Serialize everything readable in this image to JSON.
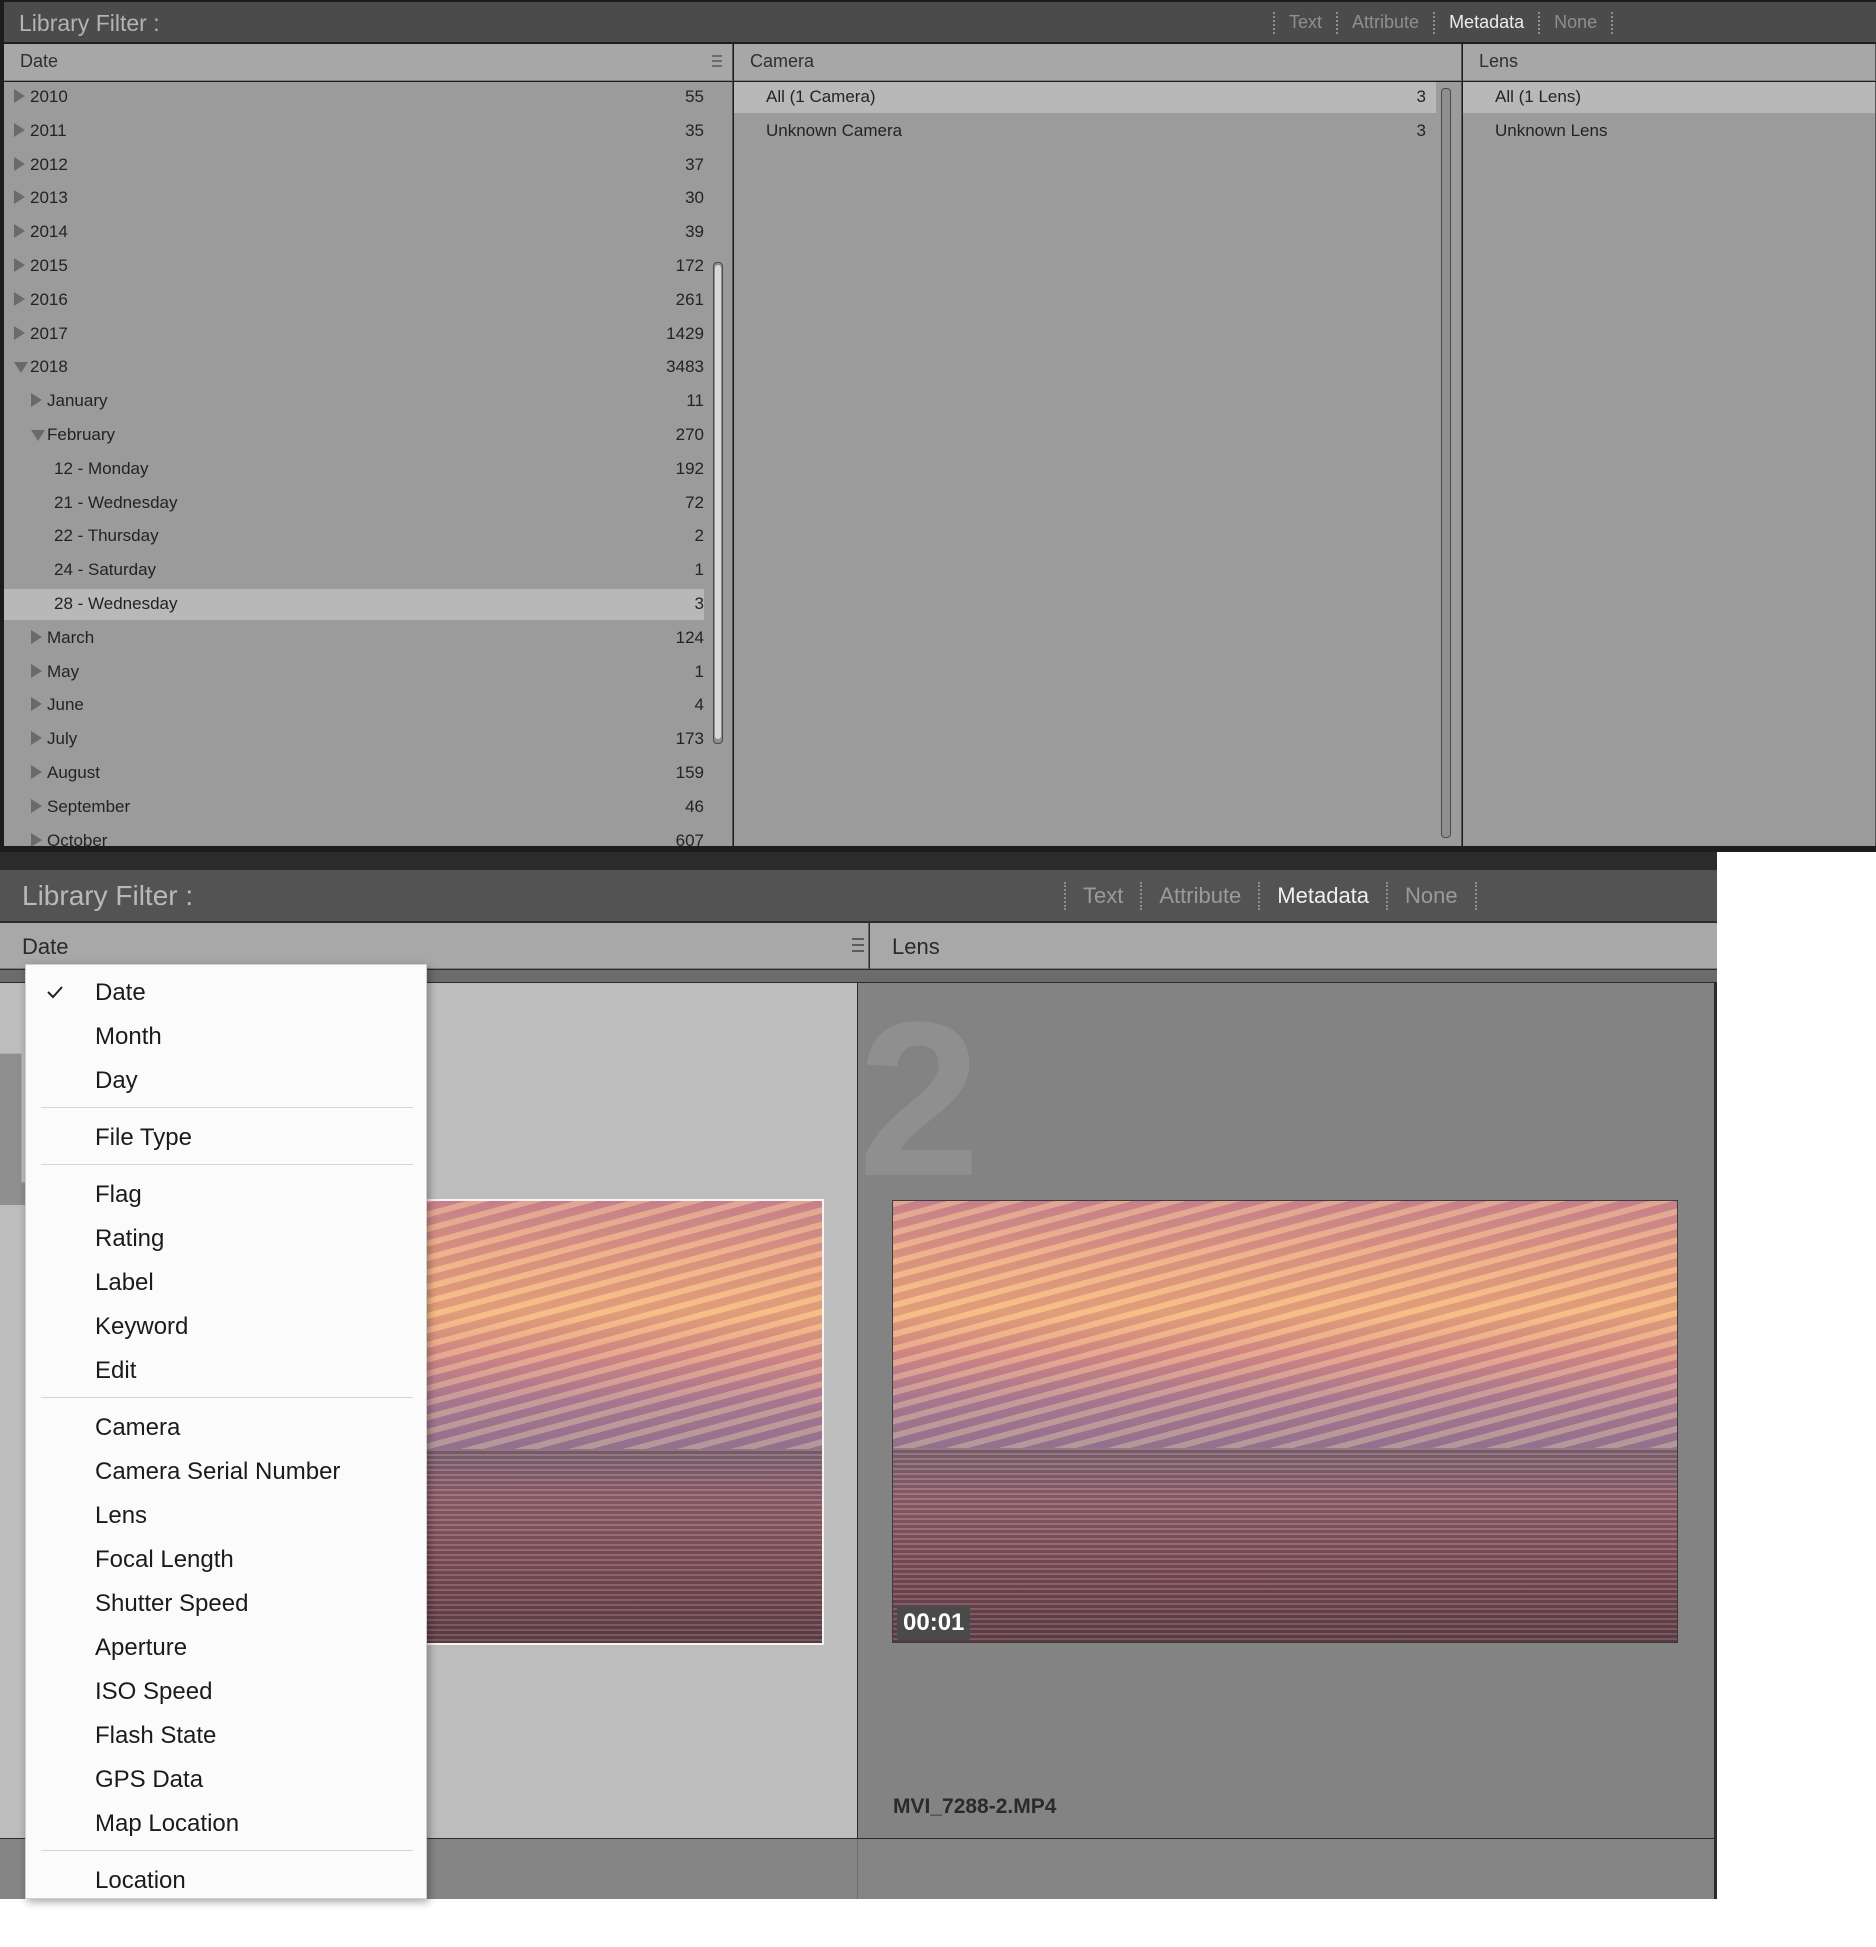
{
  "top": {
    "title": "Library Filter :",
    "tabs": [
      "Text",
      "Attribute",
      "Metadata",
      "None"
    ],
    "active_tab": "Metadata",
    "columns": {
      "date": {
        "header": "Date",
        "rows": [
          {
            "label": "2010",
            "count": "55",
            "level": 0,
            "expanded": false,
            "selected": false
          },
          {
            "label": "2011",
            "count": "35",
            "level": 0,
            "expanded": false,
            "selected": false
          },
          {
            "label": "2012",
            "count": "37",
            "level": 0,
            "expanded": false,
            "selected": false
          },
          {
            "label": "2013",
            "count": "30",
            "level": 0,
            "expanded": false,
            "selected": false
          },
          {
            "label": "2014",
            "count": "39",
            "level": 0,
            "expanded": false,
            "selected": false
          },
          {
            "label": "2015",
            "count": "172",
            "level": 0,
            "expanded": false,
            "selected": false
          },
          {
            "label": "2016",
            "count": "261",
            "level": 0,
            "expanded": false,
            "selected": false
          },
          {
            "label": "2017",
            "count": "1429",
            "level": 0,
            "expanded": false,
            "selected": false
          },
          {
            "label": "2018",
            "count": "3483",
            "level": 0,
            "expanded": true,
            "selected": false
          },
          {
            "label": "January",
            "count": "11",
            "level": 1,
            "expanded": false,
            "selected": false
          },
          {
            "label": "February",
            "count": "270",
            "level": 1,
            "expanded": true,
            "selected": false
          },
          {
            "label": "12 - Monday",
            "count": "192",
            "level": 2,
            "expanded": null,
            "selected": false
          },
          {
            "label": "21 - Wednesday",
            "count": "72",
            "level": 2,
            "expanded": null,
            "selected": false
          },
          {
            "label": "22 - Thursday",
            "count": "2",
            "level": 2,
            "expanded": null,
            "selected": false
          },
          {
            "label": "24 - Saturday",
            "count": "1",
            "level": 2,
            "expanded": null,
            "selected": false
          },
          {
            "label": "28 - Wednesday",
            "count": "3",
            "level": 2,
            "expanded": null,
            "selected": true
          },
          {
            "label": "March",
            "count": "124",
            "level": 1,
            "expanded": false,
            "selected": false
          },
          {
            "label": "May",
            "count": "1",
            "level": 1,
            "expanded": false,
            "selected": false
          },
          {
            "label": "June",
            "count": "4",
            "level": 1,
            "expanded": false,
            "selected": false
          },
          {
            "label": "July",
            "count": "173",
            "level": 1,
            "expanded": false,
            "selected": false
          },
          {
            "label": "August",
            "count": "159",
            "level": 1,
            "expanded": false,
            "selected": false
          },
          {
            "label": "September",
            "count": "46",
            "level": 1,
            "expanded": false,
            "selected": false
          },
          {
            "label": "October",
            "count": "607",
            "level": 1,
            "expanded": false,
            "selected": false
          }
        ]
      },
      "camera": {
        "header": "Camera",
        "rows": [
          {
            "label": "All (1 Camera)",
            "count": "3",
            "selected": true
          },
          {
            "label": "Unknown Camera",
            "count": "3",
            "selected": false
          }
        ]
      },
      "lens": {
        "header": "Lens",
        "rows": [
          {
            "label": "All (1 Lens)",
            "count": "",
            "selected": true
          },
          {
            "label": "Unknown Lens",
            "count": "",
            "selected": false
          }
        ]
      }
    }
  },
  "bottom": {
    "title": "Library Filter :",
    "tabs": [
      "Text",
      "Attribute",
      "Metadata",
      "None"
    ],
    "active_tab": "Metadata",
    "date_header": "Date",
    "lens_header": "Lens",
    "cells": [
      {
        "index": "1"
      },
      {
        "index": "2",
        "duration": "00:01",
        "filename": "MVI_7288-2.MP4"
      }
    ],
    "menu": {
      "groups": [
        [
          "Date",
          "Month",
          "Day"
        ],
        [
          "File Type"
        ],
        [
          "Flag",
          "Rating",
          "Label",
          "Keyword",
          "Edit"
        ],
        [
          "Camera",
          "Camera Serial Number",
          "Lens",
          "Focal Length",
          "Shutter Speed",
          "Aperture",
          "ISO Speed",
          "Flash State",
          "GPS Data",
          "Map Location"
        ],
        [
          "Location"
        ]
      ],
      "checked": "Date"
    }
  }
}
